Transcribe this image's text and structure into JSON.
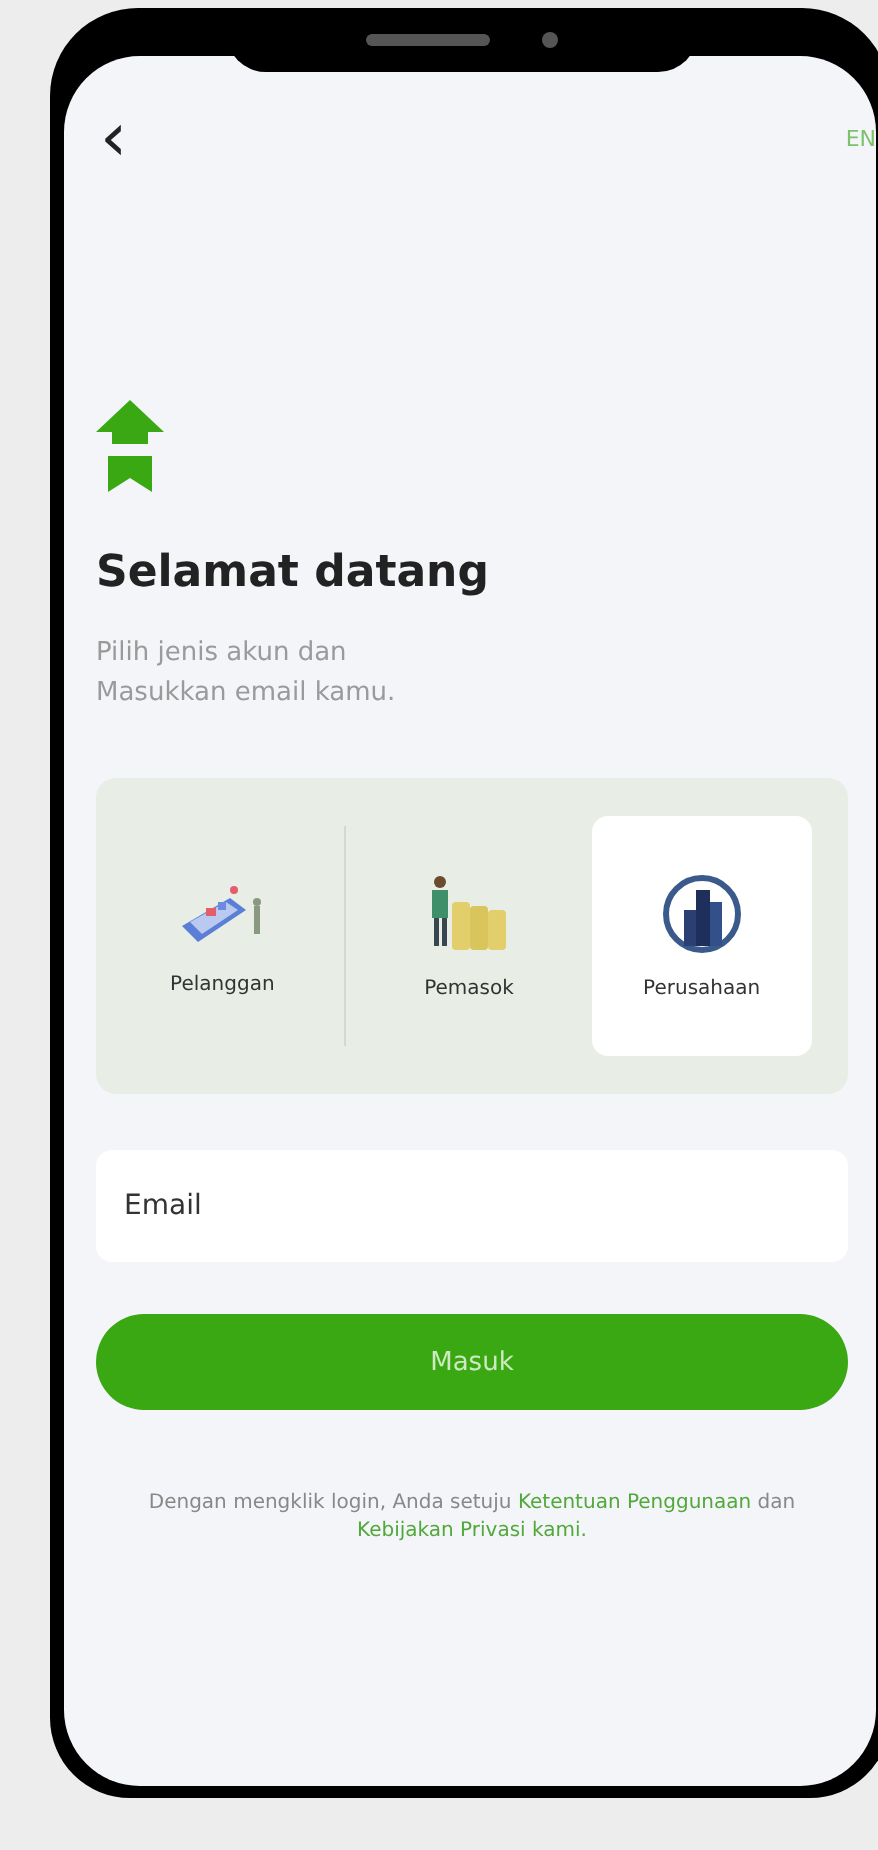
{
  "header": {
    "back_icon": "‹",
    "language": "EN"
  },
  "title": "Selamat datang",
  "subtitle": "Pilih jenis akun dan\nMasukkan email kamu.",
  "account_types": [
    {
      "label": "Pelanggan",
      "kind": "ship",
      "selected": false
    },
    {
      "label": "Pemasok",
      "kind": "supplier",
      "selected": false
    },
    {
      "label": "Perusahaan",
      "kind": "building",
      "selected": true
    }
  ],
  "email": {
    "placeholder": "Email"
  },
  "login_button": "Masuk",
  "terms": [
    {
      "kind": "plain",
      "text": "Dengan mengklik login, Anda setuju "
    },
    {
      "kind": "link",
      "text": "Ketentuan Penggunaan"
    },
    {
      "kind": "plain",
      "text": " dan "
    },
    {
      "kind": "link",
      "text": "Kebijakan Privasi kami."
    }
  ]
}
